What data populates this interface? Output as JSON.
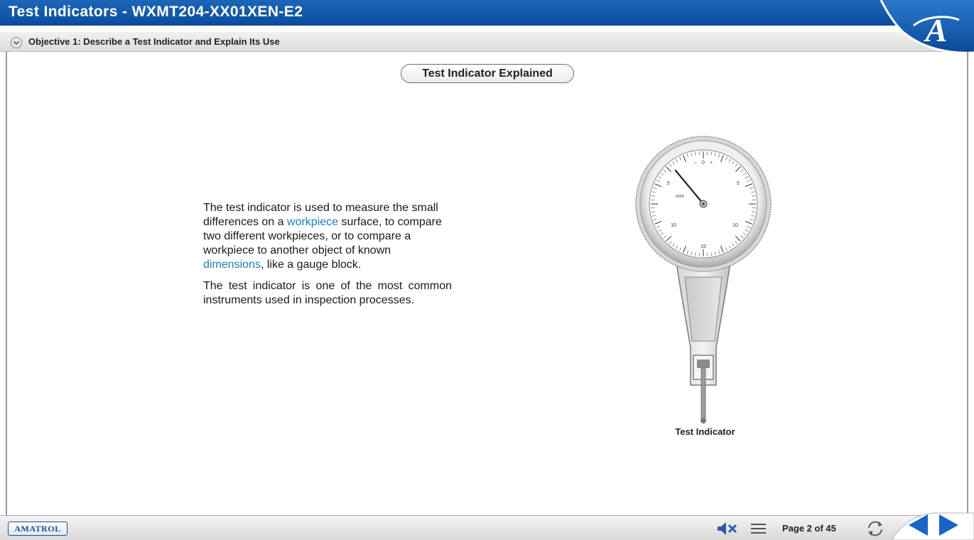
{
  "window": {
    "title": "Test Indicators - WXMT204-XX01XEN-E2"
  },
  "objective": {
    "label": "Objective 1: Describe a Test Indicator and Explain Its Use"
  },
  "logo": {
    "letter": "A"
  },
  "section": {
    "title": "Test Indicator Explained"
  },
  "body": {
    "p1_part1": "The test indicator is used to measure the small differences on a ",
    "p1_link1": "workpiece",
    "p1_part2": " surface, to compare two different workpieces, or to compare a workpiece to another object of known ",
    "p1_link2": "dimensions",
    "p1_part3": ", like a gauge block.",
    "p2": "The test indicator is one of the most common instruments used in inspection processes."
  },
  "figure": {
    "caption": "Test Indicator",
    "dial_labels": {
      "zero": "0",
      "minus": "–",
      "plus": "+",
      "left5": "5",
      "right5": "5",
      "left10": "10",
      "right10": "10",
      "bottom15": "15",
      "resolution": ".0005\""
    }
  },
  "footer": {
    "brand": "AMATROL",
    "page_label": "Page 2 of 45"
  },
  "colors": {
    "title_bar": "#0b4c9c",
    "link": "#1f7bb3",
    "nav_arrow": "#1a64c4"
  },
  "icons": {
    "objective_toggle": "chevron-down-icon",
    "mute": "mute-icon",
    "menu": "menu-icon",
    "refresh": "refresh-icon",
    "prev": "prev-arrow-icon",
    "next": "next-arrow-icon"
  }
}
